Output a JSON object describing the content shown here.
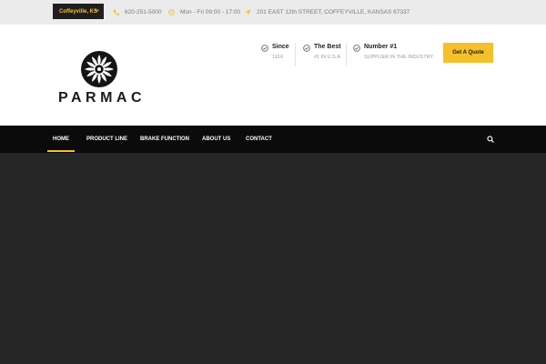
{
  "topbar": {
    "location_select": "Coffeyville, KS",
    "phone": "620-251-5000",
    "hours": "Mon - Fri 09:00 - 17:00",
    "address": "201 EAST 12th STREET, COFFEYVILLE, KANSAS 67337"
  },
  "header": {
    "logo_text": "PARMAC",
    "features": [
      {
        "title": "Since",
        "subtitle": "1916"
      },
      {
        "title": "The Best",
        "subtitle": "#1 IN U.S.A"
      },
      {
        "title": "Number #1",
        "subtitle": "SUPPLIER IN THE INDUSTRY"
      }
    ],
    "quote_button": "Get A Quote"
  },
  "nav": {
    "items": [
      "HOME",
      "PRODUCT LINE",
      "BRAKE FUNCTION",
      "ABOUT US",
      "CONTACT"
    ],
    "active_index": 0
  },
  "colors": {
    "accent": "#f5c02a",
    "topbar_bg": "#ebebeb",
    "nav_bg": "#0b0b0b",
    "hero_bg": "#262626"
  },
  "icons": {
    "phone": "phone-icon",
    "hours": "clock-icon",
    "address": "location-arrow-icon",
    "feature": "check-circle-icon",
    "search": "search-icon",
    "select": "chevron-down-icon"
  }
}
